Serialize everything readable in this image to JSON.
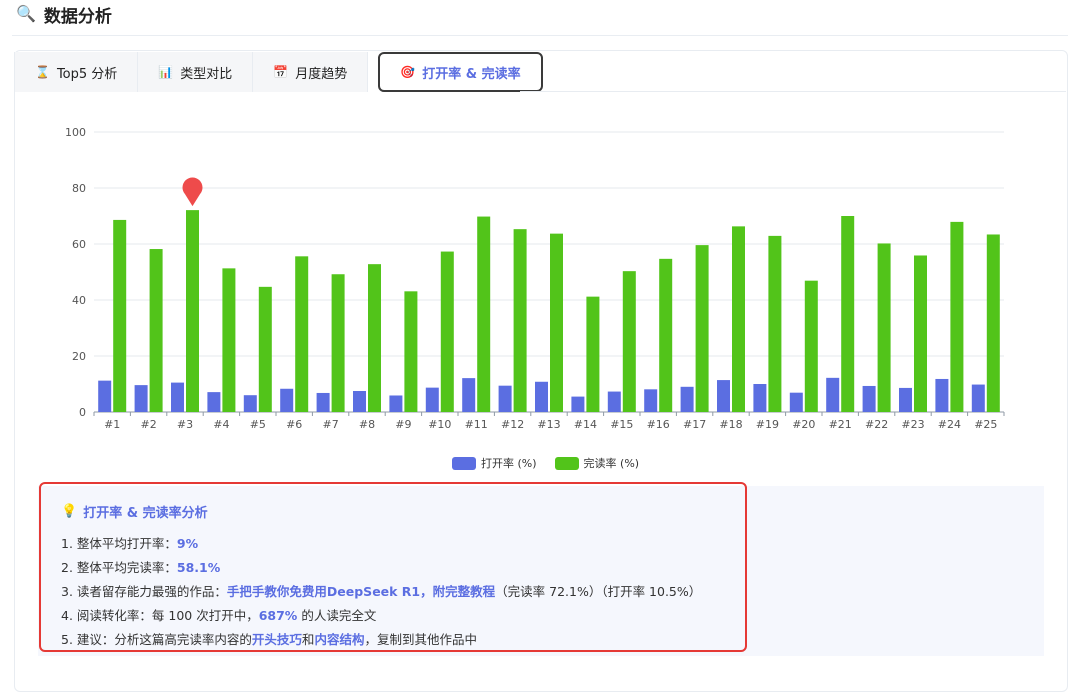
{
  "header": {
    "icon": "magnifier-icon",
    "title": "数据分析"
  },
  "tabs": [
    {
      "icon": "hourglass-icon",
      "label": "Top5 分析",
      "active": false
    },
    {
      "icon": "bar-chart-icon",
      "label": "类型对比",
      "active": false
    },
    {
      "icon": "calendar-icon",
      "label": "月度趋势",
      "active": false
    },
    {
      "icon": "target-icon",
      "label": "打开率 & 完读率",
      "active": true
    }
  ],
  "chart_data": {
    "type": "bar",
    "categories": [
      "#1",
      "#2",
      "#3",
      "#4",
      "#5",
      "#6",
      "#7",
      "#8",
      "#9",
      "#10",
      "#11",
      "#12",
      "#13",
      "#14",
      "#15",
      "#16",
      "#17",
      "#18",
      "#19",
      "#20",
      "#21",
      "#22",
      "#23",
      "#24",
      "#25"
    ],
    "series": [
      {
        "name": "打开率 (%)",
        "color": "#5b6ee1",
        "values": [
          11.2,
          9.6,
          10.5,
          7.1,
          6.0,
          8.3,
          6.8,
          7.5,
          5.9,
          8.7,
          12.1,
          9.4,
          10.8,
          5.5,
          7.3,
          8.1,
          9.0,
          11.4,
          10.0,
          6.9,
          12.2,
          9.3,
          8.6,
          11.8,
          9.8
        ]
      },
      {
        "name": "完读率 (%)",
        "color": "#52c41a",
        "values": [
          68.6,
          58.2,
          72.1,
          51.3,
          44.7,
          55.6,
          49.2,
          52.8,
          43.1,
          57.3,
          69.8,
          65.3,
          63.7,
          41.2,
          50.3,
          54.7,
          59.6,
          66.3,
          62.9,
          46.9,
          70.0,
          60.2,
          55.9,
          67.9,
          63.4
        ]
      }
    ],
    "ylim": [
      0,
      100
    ],
    "yticks": [
      0,
      20,
      40,
      60,
      80,
      100
    ],
    "grid": true,
    "legend": "bottom-center",
    "marker": {
      "category": "#3",
      "color": "#ee4b4b"
    }
  },
  "analysis": {
    "icon": "lightbulb-icon",
    "title": "打开率 & 完读率分析",
    "line1": {
      "prefix": "1. 整体平均打开率：",
      "value": "9%"
    },
    "line2": {
      "prefix": "2. 整体平均完读率：",
      "value": "58.1%"
    },
    "line3": {
      "prefix": "3. 读者留存能力最强的作品：",
      "work": "手把手教你免费用DeepSeek R1，附完整教程",
      "suffix": "（完读率 72.1%）（打开率 10.5%）"
    },
    "line4": {
      "prefix": "4. 阅读转化率：每 100 次打开中，",
      "value": "687%",
      "suffix": " 的人读完全文"
    },
    "line5": {
      "prefix": "5. 建议：分析这篇高完读率内容的",
      "h1": "开头技巧",
      "mid": "和",
      "h2": "内容结构",
      "suffix": "，复制到其他作品中"
    }
  }
}
